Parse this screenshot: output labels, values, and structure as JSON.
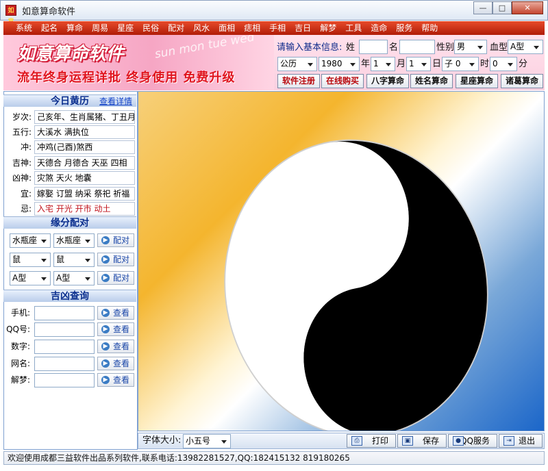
{
  "window": {
    "title": "如意算命软件",
    "app_icon_text": "如意",
    "btn_min": "—",
    "btn_max": "□",
    "btn_close": "✕"
  },
  "menu": [
    "系统",
    "起名",
    "算命",
    "周易",
    "星座",
    "民俗",
    "配对",
    "风水",
    "面相",
    "痣相",
    "手相",
    "吉日",
    "解梦",
    "工具",
    "造命",
    "服务",
    "帮助"
  ],
  "banner": {
    "title": "如意算命软件",
    "slogan": "流年终身运程详批  终身使用  免费升级",
    "decor": "sun mon tue wed"
  },
  "info": {
    "prompt": "请输入基本信息:",
    "surname_label": "姓",
    "name_label": "名",
    "gender_label": "性别",
    "gender": "男",
    "blood_label": "血型",
    "blood": "A型",
    "calendar": "公历",
    "year": "1980",
    "year_label": "年",
    "month": "1",
    "month_label": "月",
    "day": "1",
    "day_label": "日",
    "shichen": "子 0",
    "hour_label": "时",
    "minute": "0",
    "minute_label": "分",
    "btn_register": "软件注册",
    "btn_buy": "在线购买",
    "btn_bazi": "八字算命",
    "btn_xingming": "姓名算命",
    "btn_xingzuo": "星座算命",
    "btn_zhuge": "诸葛算命"
  },
  "almanac": {
    "header": "今日黄历",
    "detail_link": "查看详情",
    "rows": [
      {
        "label": "岁次:",
        "value": "己亥年、生肖属猪、丁丑月"
      },
      {
        "label": "五行:",
        "value": "大溪水 满执位"
      },
      {
        "label": "冲:",
        "value": "冲鸡(己酉)煞西"
      },
      {
        "label": "吉神:",
        "value": "天德合 月德合 天巫 四相"
      },
      {
        "label": "凶神:",
        "value": "灾煞 天火 地囊"
      },
      {
        "label": "宜:",
        "value": "嫁娶 订盟 纳采 祭祀 祈福"
      },
      {
        "label": "忌:",
        "value": "入宅 开光 开市 动土"
      }
    ]
  },
  "match": {
    "header": "缘分配对",
    "btn_label": "配对",
    "rows": [
      {
        "a": "水瓶座",
        "b": "水瓶座"
      },
      {
        "a": "鼠",
        "b": "鼠"
      },
      {
        "a": "A型",
        "b": "A型"
      }
    ]
  },
  "query": {
    "header": "吉凶查询",
    "btn_label": "查看",
    "rows": [
      {
        "label": "手机:",
        "value": ""
      },
      {
        "label": "QQ号:",
        "value": ""
      },
      {
        "label": "数字:",
        "value": ""
      },
      {
        "label": "网名:",
        "value": ""
      },
      {
        "label": "解梦:",
        "value": ""
      }
    ]
  },
  "bottom": {
    "font_size_label": "字体大小:",
    "font_size": "小五号",
    "btn_print": "打印",
    "btn_save": "保存",
    "btn_qq": "QQ服务",
    "btn_exit": "退出"
  },
  "status": "欢迎使用成都三益软件出品系列软件,联系电话:13982281527,QQ:182415132 819180265"
}
